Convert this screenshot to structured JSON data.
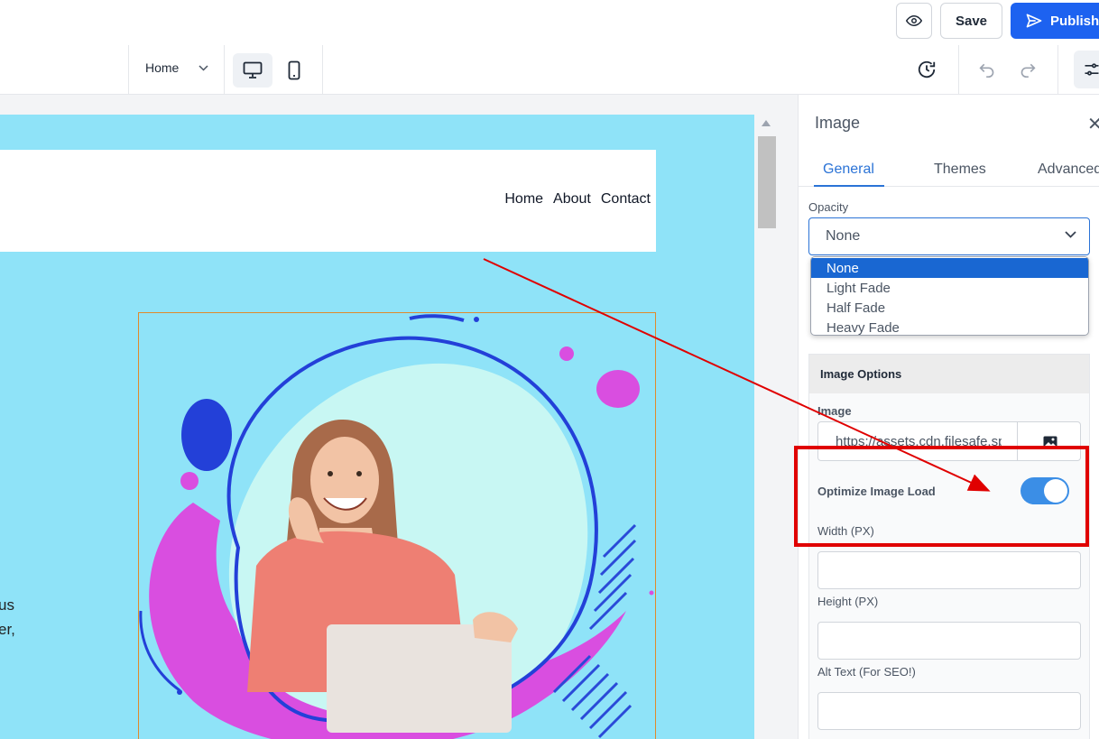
{
  "header": {
    "save_label": "Save",
    "publish_label": "Publish",
    "page_selector": "Home"
  },
  "site": {
    "nav": [
      "Home",
      "About",
      "Contact"
    ],
    "clipped_text": [
      "us",
      "er,"
    ]
  },
  "panel": {
    "title": "Image",
    "tabs": [
      "General",
      "Themes",
      "Advanced"
    ],
    "active_tab": "General",
    "opacity": {
      "label": "Opacity",
      "value": "None",
      "options": [
        "None",
        "Light Fade",
        "Half Fade",
        "Heavy Fade"
      ],
      "selected_index": 0
    },
    "image_options": {
      "heading": "Image Options",
      "image_label": "Image",
      "image_url": "https://assets.cdn.filesafe.space/",
      "optimize_label": "Optimize Image Load",
      "optimize_on": true,
      "width_label": "Width (PX)",
      "height_label": "Height (PX)",
      "alt_label": "Alt Text (For SEO!)"
    }
  },
  "colors": {
    "accent": "#1d62f0",
    "canvas_bg": "#8fe3f8",
    "annotation": "#e00000"
  }
}
